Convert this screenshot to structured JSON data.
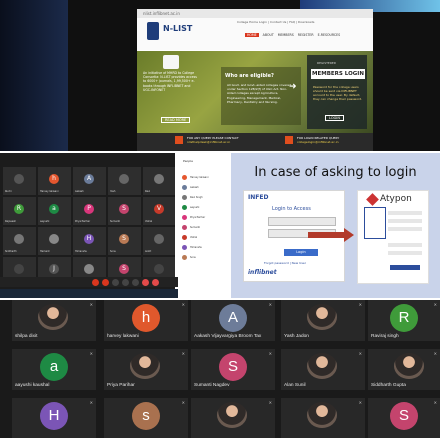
{
  "website": {
    "browser_url": "nlist.inflibnet.ac.in",
    "brand": "N-LIST",
    "brand_sub": "National Library and Information Services Infrastructure for Scholarly Content",
    "top_links": "College Home Login | Contact Us | FAQ | Downloads",
    "nav": [
      "HOME",
      "ABOUT",
      "MEMBERS",
      "REGISTER",
      "E-RESOURCES",
      "NEWS"
    ],
    "hero_left_text": "An initiative of MHRD to College Consortia: N-LIST provides access to 6000+ journals, 1,99,500+ e-books through INFLIBNET and UGC-INFONET",
    "read_more": "READ MORE",
    "who_eligible_title": "Who are eligible?",
    "who_eligible_text": "All Govt. and Govt.-aided colleges covered under Section 12B/2(f) of UGC Act. Non-Aided colleges except Agriculture, Engineering, Management, Medical, Pharmacy, Dentistry and Nursing.",
    "register_title": "REGISTERED",
    "register_button": "MEMBERS LOGIN",
    "register_note": "Password for the college users should be sent via INFLIBNET account to the user. By default, they can change their password.",
    "login_button": "LOGIN",
    "footer_left_label": "FOR ANY QUERY PLEASE CONTACT",
    "footer_left_email": "nlisthelpdesk@inflibnet.ac.in",
    "footer_right_label": "FOR LOGIN RELATED QUERY",
    "footer_right_email": "collegelogin@inflibnet.ac.in"
  },
  "zoom_small": {
    "tiles": [
      {
        "name": "Ruchi",
        "initial": "",
        "color": "#555555"
      },
      {
        "name": "Harvey lakwani",
        "initial": "h",
        "color": "#e5572f"
      },
      {
        "name": "Aakash",
        "initial": "A",
        "color": "#6b7c9a"
      },
      {
        "name": "Yash",
        "initial": "",
        "color": "#666666"
      },
      {
        "name": "Ravi",
        "initial": "",
        "color": "#777777"
      },
      {
        "name": "Rajneesh",
        "initial": "R",
        "color": "#3f9b3a"
      },
      {
        "name": "aayushi",
        "initial": "a",
        "color": "#1e8a44"
      },
      {
        "name": "Priya Parihar",
        "initial": "P",
        "color": "#d9367b"
      },
      {
        "name": "Sumanti",
        "initial": "S",
        "color": "#c4446d"
      },
      {
        "name": "Vishal",
        "initial": "V",
        "color": "#c73a2a"
      },
      {
        "name": "Siddharth",
        "initial": "",
        "color": "#777777"
      },
      {
        "name": "Hemant",
        "initial": "",
        "color": "#888888"
      },
      {
        "name": "Himanshu",
        "initial": "H",
        "color": "#7b55b6"
      },
      {
        "name": "Sonu",
        "initial": "S",
        "color": "#b97a55"
      },
      {
        "name": "Ankit",
        "initial": "",
        "color": "#666666"
      },
      {
        "name": "",
        "initial": "",
        "color": "#444444"
      },
      {
        "name": "Javanna Singh",
        "initial": "J",
        "color": "#555555"
      },
      {
        "name": "Yashwant",
        "initial": "",
        "color": "#888888"
      },
      {
        "name": "Sumer",
        "initial": "S",
        "color": "#c4446d"
      },
      {
        "name": "",
        "initial": "",
        "color": "#444444"
      }
    ],
    "side_title": "People",
    "side_list": [
      "Harvey lakwani",
      "Aakash",
      "Ravi Singh",
      "aayushi",
      "Priya Parihar",
      "Sumanti",
      "Vishal",
      "Himanshu",
      "Sonu"
    ]
  },
  "login_panel": {
    "title": "In case of asking to login",
    "inflibnet_logo": "INFED",
    "login_title": "Login to Access",
    "login_button": "Login",
    "links": "Forgot password | New User",
    "inflibnet_footer": "inflibnet",
    "atypon_brand": "Atypon"
  },
  "zoom_large": {
    "row1": [
      {
        "name": "shilpa dixit",
        "initial": "",
        "kind": "photo"
      },
      {
        "name": "harvey lakwani",
        "initial": "h",
        "color": "#e0582c"
      },
      {
        "name": "Aakash Vijayvargiya Broom Tax",
        "initial": "A",
        "color": "#6d7c99"
      },
      {
        "name": "Yash Jadon",
        "initial": "",
        "kind": "photo"
      },
      {
        "name": "Raviraj singh",
        "initial": "R",
        "color": "#3f9b3a"
      }
    ],
    "row2": [
      {
        "name": "aayushi kaushal",
        "initial": "a",
        "color": "#1e8a44"
      },
      {
        "name": "Priya Parihar",
        "initial": "",
        "kind": "photo"
      },
      {
        "name": "Sumanti Nagdev",
        "initial": "S",
        "color": "#c4446d"
      },
      {
        "name": "Alan Sunil",
        "initial": "",
        "kind": "photo"
      },
      {
        "name": "Siddharth Gupta",
        "initial": "",
        "kind": "photo"
      }
    ],
    "row3": [
      {
        "name": "",
        "initial": "H",
        "color": "#7b55b6"
      },
      {
        "name": "",
        "initial": "s",
        "color": "#a9714f"
      },
      {
        "name": "",
        "initial": "",
        "kind": "photo"
      },
      {
        "name": "",
        "initial": "",
        "kind": "photo"
      },
      {
        "name": "",
        "initial": "S",
        "color": "#c4446d"
      }
    ]
  }
}
